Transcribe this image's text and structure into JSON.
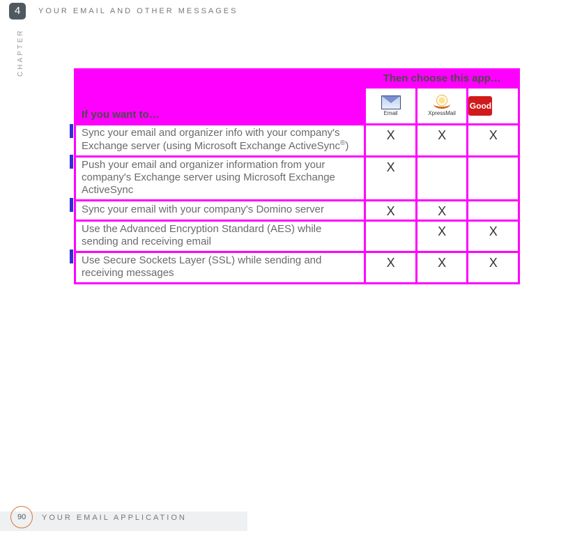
{
  "header": {
    "chapter_number": "4",
    "chapter_title": "YOUR EMAIL AND OTHER MESSAGES",
    "side_label": "CHAPTER"
  },
  "footer": {
    "page_number": "90",
    "section_title": "YOUR EMAIL APPLICATION"
  },
  "table": {
    "lead_header": "If you want to…",
    "choose_header": "Then choose this app…",
    "apps": [
      {
        "name": "Email",
        "caption": "Email"
      },
      {
        "name": "XpressMail",
        "caption": "XpressMail"
      },
      {
        "name": "Good",
        "caption": "Good"
      }
    ],
    "rows": [
      {
        "has_bar": true,
        "desc_pre": "Sync your email and organizer info with your company's Exchange server (using Microsoft Exchange ActiveSync",
        "desc_sup": "®",
        "desc_post": ")",
        "marks": [
          "X",
          "X",
          "X"
        ]
      },
      {
        "has_bar": true,
        "desc": "Push your email and organizer information from your company's Exchange server using Microsoft Exchange ActiveSync",
        "marks": [
          "X",
          "",
          ""
        ]
      },
      {
        "has_bar": true,
        "desc": "Sync your email with your company's Domino server",
        "marks": [
          "X",
          "X",
          ""
        ]
      },
      {
        "has_bar": false,
        "desc": "Use the Advanced Encryption Standard (AES) while sending and receiving email",
        "marks": [
          "",
          "X",
          "X"
        ]
      },
      {
        "has_bar": true,
        "desc": "Use Secure Sockets Layer (SSL) while sending and receiving messages",
        "marks": [
          "X",
          "X",
          "X"
        ]
      }
    ]
  }
}
